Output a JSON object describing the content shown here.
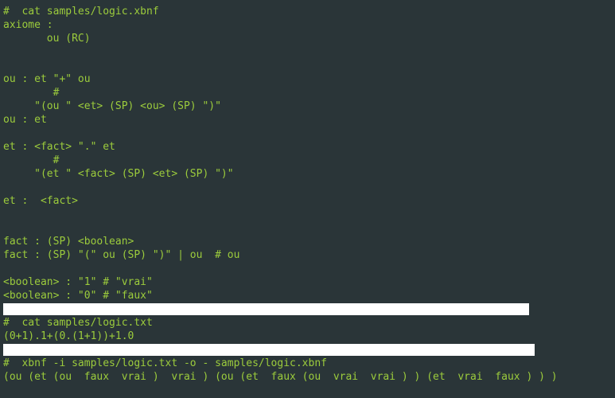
{
  "lines": [
    "#  cat samples/logic.xbnf",
    "axiome :",
    "       ou (RC)",
    "",
    "",
    "ou : et \"+\" ou",
    "        #",
    "     \"(ou \" <et> (SP) <ou> (SP) \")\"",
    "ou : et",
    "",
    "et : <fact> \".\" et",
    "        #",
    "     \"(et \" <fact> (SP) <et> (SP) \")\"",
    "",
    "et :  <fact>",
    "",
    "",
    "fact : (SP) <boolean>",
    "fact : (SP) \"(\" ou (SP) \")\" | ou  # ou",
    "",
    "<boolean> : \"1\" # \"vrai\"",
    "<boolean> : \"0\" # \"faux\""
  ],
  "highlight1_width": 661,
  "lines2": [
    "#  cat samples/logic.txt",
    "(0+1).1+(0.(1+1))+1.0"
  ],
  "highlight2_width": 668,
  "lines3": [
    "#  xbnf -i samples/logic.txt -o - samples/logic.xbnf",
    "(ou (et (ou  faux  vrai )  vrai ) (ou (et  faux (ou  vrai  vrai ) ) (et  vrai  faux ) ) )"
  ]
}
